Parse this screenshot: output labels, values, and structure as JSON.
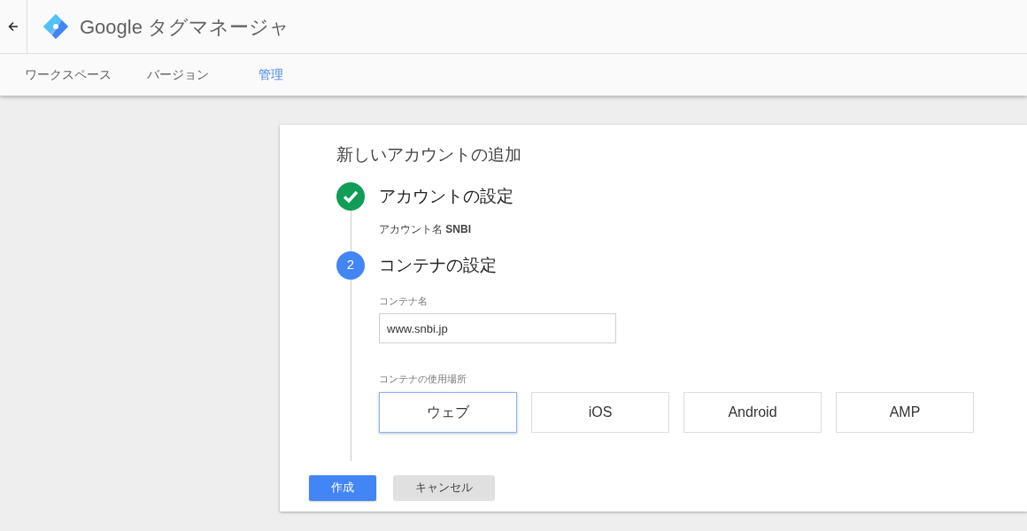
{
  "header": {
    "product_name": "Google タグマネージャ"
  },
  "tabs": [
    {
      "label": "ワークスペース",
      "selected": false
    },
    {
      "label": "バージョン",
      "selected": false
    },
    {
      "label": "管理",
      "selected": true
    }
  ],
  "dialog": {
    "title": "新しいアカウントの追加",
    "steps": [
      {
        "kind": "complete",
        "title": "アカウントの設定",
        "summary": "アカウント名 **SNBI**"
      },
      {
        "kind": "current",
        "number": "2",
        "title": "コンテナの設定",
        "container_name": {
          "label": "コンテナ名",
          "value": "www.snbi.jp"
        },
        "platform_label": "コンテナの使用場所",
        "platforms": [
          {
            "label": "ウェブ",
            "selected": true
          },
          {
            "label": "iOS",
            "selected": false
          },
          {
            "label": "Android",
            "selected": false
          },
          {
            "label": "AMP",
            "selected": false
          }
        ]
      }
    ],
    "buttons": [
      {
        "kind": "primary",
        "label": "作成"
      },
      {
        "kind": "secondary",
        "label": "キャンセル"
      }
    ]
  }
}
